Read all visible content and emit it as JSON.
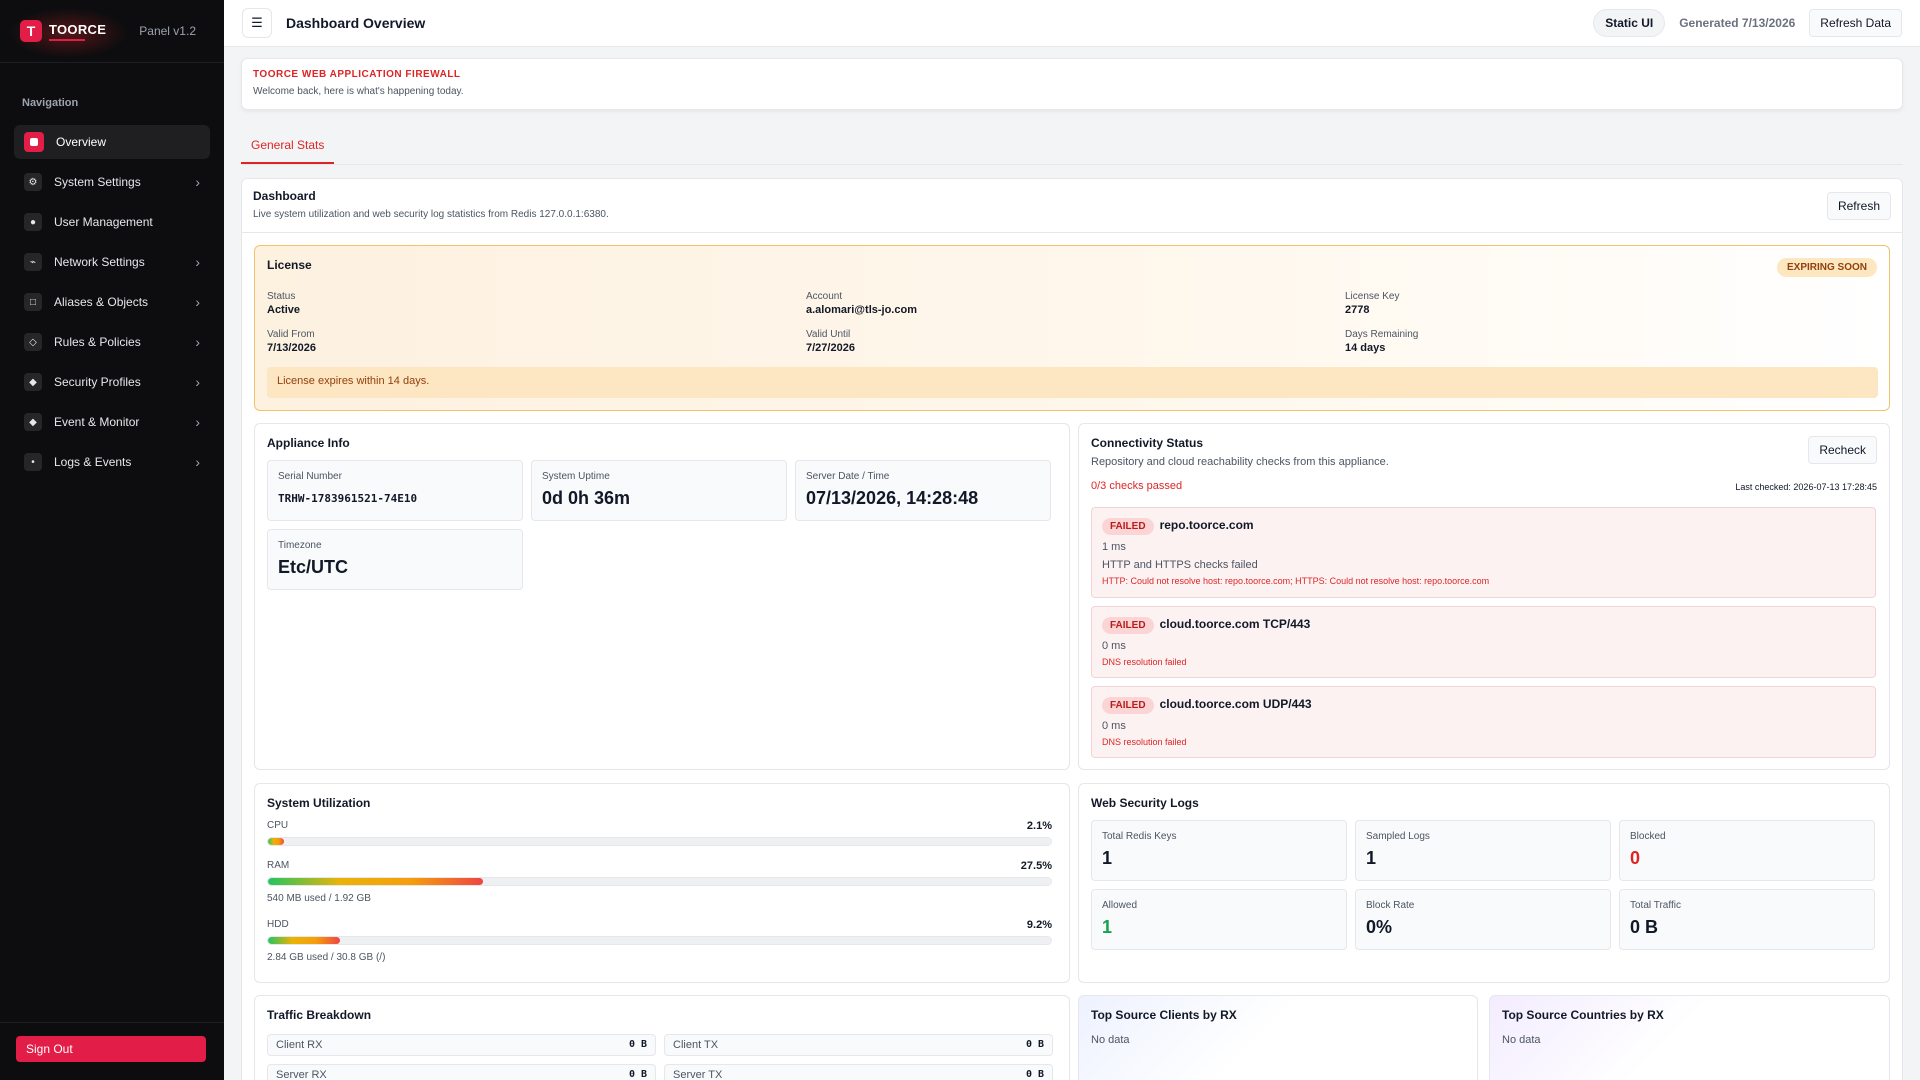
{
  "brand": {
    "logo_letter": "T",
    "name": "TOORCE",
    "version": "Panel v1.2"
  },
  "nav": {
    "title": "Navigation",
    "items": [
      {
        "label": "Overview",
        "icon": "overview-icon",
        "active": true,
        "chevron": false
      },
      {
        "label": "System Settings",
        "icon": "gear-icon",
        "glyph": "⚙",
        "chevron": true
      },
      {
        "label": "User Management",
        "icon": "user-icon",
        "glyph": "●",
        "chevron": false
      },
      {
        "label": "Network Settings",
        "icon": "network-icon",
        "glyph": "⌁",
        "chevron": true
      },
      {
        "label": "Aliases & Objects",
        "icon": "object-icon",
        "glyph": "□",
        "chevron": true
      },
      {
        "label": "Rules & Policies",
        "icon": "rules-icon",
        "glyph": "◇",
        "chevron": true
      },
      {
        "label": "Security Profiles",
        "icon": "shield-icon",
        "glyph": "◆",
        "chevron": true
      },
      {
        "label": "Event & Monitor",
        "icon": "monitor-icon",
        "glyph": "◆",
        "chevron": true
      },
      {
        "label": "Logs & Events",
        "icon": "logs-icon",
        "glyph": "•",
        "chevron": true
      }
    ],
    "chevron_glyph": "›",
    "signout": "Sign Out"
  },
  "topbar": {
    "menu_glyph": "☰",
    "title": "Dashboard Overview",
    "pill": "Static UI",
    "generated": "Generated 7/13/2026",
    "refresh": "Refresh Data"
  },
  "header": {
    "kicker": "TOORCE WEB APPLICATION FIREWALL",
    "sub": "Welcome back, here is what's happening today."
  },
  "tabs": [
    "General Stats"
  ],
  "dashboard": {
    "title": "Dashboard",
    "desc": "Live system utilization and web security log statistics from Redis 127.0.0.1:6380.",
    "refresh": "Refresh"
  },
  "license": {
    "title": "License",
    "badge": "EXPIRING SOON",
    "fields": [
      {
        "k": "Status",
        "v": "Active"
      },
      {
        "k": "Account",
        "v": "a.alomari@tls-jo.com"
      },
      {
        "k": "License Key",
        "v": "2778"
      },
      {
        "k": "Valid From",
        "v": "7/13/2026"
      },
      {
        "k": "Valid Until",
        "v": "7/27/2026"
      },
      {
        "k": "Days Remaining",
        "v": "14 days"
      }
    ],
    "warning": "License expires within 14 days."
  },
  "appliance": {
    "title": "Appliance Info",
    "serial": {
      "k": "Serial Number",
      "v": "TRHW-1783961521-74E10"
    },
    "uptime": {
      "k": "System Uptime",
      "v": "0d 0h 36m"
    },
    "datetime": {
      "k": "Server Date / Time",
      "v": "07/13/2026, 14:28:48"
    },
    "timezone": {
      "k": "Timezone",
      "v": "Etc/UTC"
    }
  },
  "connectivity": {
    "title": "Connectivity Status",
    "desc": "Repository and cloud reachability checks from this appliance.",
    "recheck": "Recheck",
    "status": "0/3 checks passed",
    "last_checked": "Last checked: 2026-07-13 17:28:45",
    "items": [
      {
        "badge": "FAILED",
        "host": "repo.toorce.com",
        "ms": "1 ms",
        "msg": "HTTP and HTTPS checks failed",
        "err": "HTTP: Could not resolve host: repo.toorce.com; HTTPS: Could not resolve host: repo.toorce.com"
      },
      {
        "badge": "FAILED",
        "host": "cloud.toorce.com TCP/443",
        "ms": "0 ms",
        "err": "DNS resolution failed"
      },
      {
        "badge": "FAILED",
        "host": "cloud.toorce.com UDP/443",
        "ms": "0 ms",
        "err": "DNS resolution failed"
      }
    ]
  },
  "utilization": {
    "title": "System Utilization",
    "cpu": {
      "label": "CPU",
      "pct": "2.1%",
      "value": 0.021
    },
    "ram": {
      "label": "RAM",
      "pct": "27.5%",
      "value": 0.275,
      "sub": "540 MB used / 1.92 GB"
    },
    "hdd": {
      "label": "HDD",
      "pct": "9.2%",
      "value": 0.092,
      "sub": "2.84 GB used / 30.8 GB (/)"
    }
  },
  "weblogs": {
    "title": "Web Security Logs",
    "stats": [
      {
        "k": "Total Redis Keys",
        "v": "1"
      },
      {
        "k": "Sampled Logs",
        "v": "1"
      },
      {
        "k": "Blocked",
        "v": "0"
      },
      {
        "k": "Allowed",
        "v": "1"
      },
      {
        "k": "Block Rate",
        "v": "0%"
      },
      {
        "k": "Total Traffic",
        "v": "0 B"
      }
    ]
  },
  "traffic": {
    "title": "Traffic Breakdown",
    "rows": [
      {
        "k": "Client RX",
        "v": "0 B"
      },
      {
        "k": "Client TX",
        "v": "0 B"
      },
      {
        "k": "Server RX",
        "v": "0 B"
      },
      {
        "k": "Server TX",
        "v": "0 B"
      }
    ]
  },
  "top_clients": {
    "title": "Top Source Clients by RX",
    "empty": "No data"
  },
  "top_countries": {
    "title": "Top Source Countries by RX",
    "empty": "No data"
  },
  "colors": {
    "accent": "#e11d48",
    "sidebar": "#0d0d0f",
    "danger": "#dc2626",
    "success": "#16a34a",
    "warning_bg": "#fde6c2"
  }
}
